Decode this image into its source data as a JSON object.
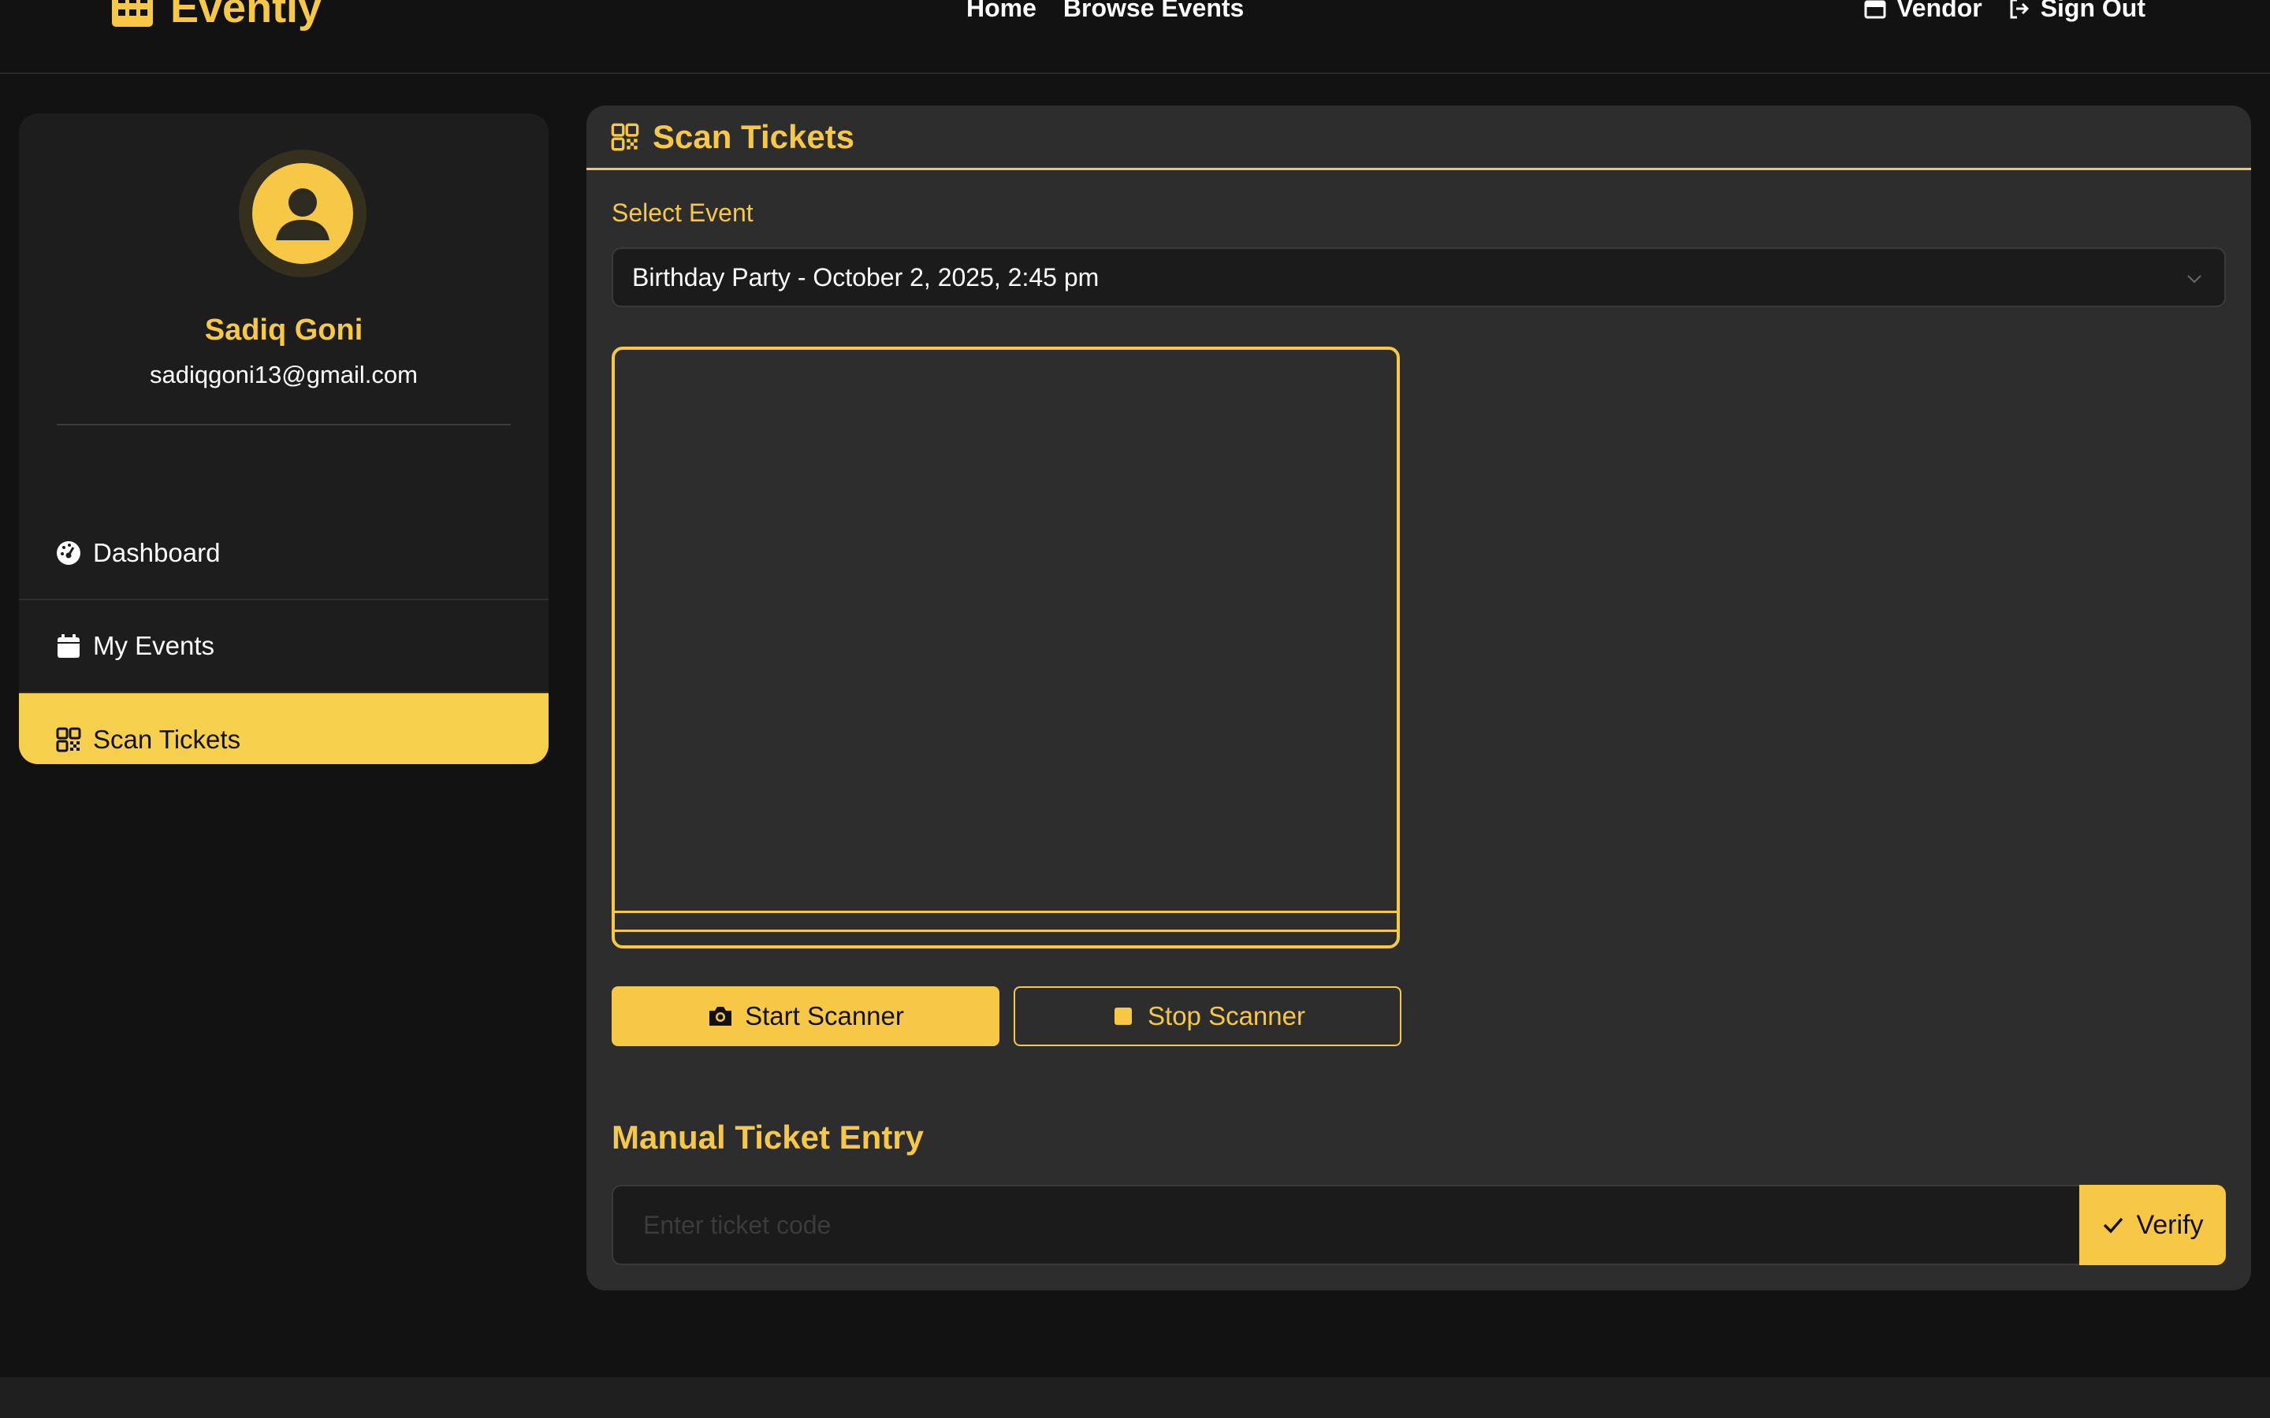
{
  "brand": {
    "name": "Eventiy"
  },
  "nav": {
    "links": [
      "Home",
      "Browse Events"
    ],
    "role_label": "Vendor",
    "signout_label": "Sign Out"
  },
  "user": {
    "name": "Sadiq Goni",
    "email": "sadiqgoni13@gmail.com"
  },
  "sidebar": {
    "items": [
      {
        "label": "Dashboard",
        "icon": "gauge-icon"
      },
      {
        "label": "My Events",
        "icon": "calendar-icon"
      },
      {
        "label": "Scan Tickets",
        "icon": "qrcode-icon",
        "active": true
      }
    ]
  },
  "main": {
    "title": "Scan Tickets",
    "select_label": "Select Event",
    "selected_event": "Birthday Party - October 2, 2025, 2:45 pm",
    "start_label": "Start Scanner",
    "stop_label": "Stop Scanner",
    "manual_title": "Manual Ticket Entry",
    "manual_placeholder": "Enter ticket code",
    "verify_label": "Verify"
  },
  "colors": {
    "accent": "#f6c845",
    "active_item": "#f6d04d",
    "background": "#121212",
    "panel": "#2d2d2d",
    "sidebar": "#1d1d1d"
  }
}
